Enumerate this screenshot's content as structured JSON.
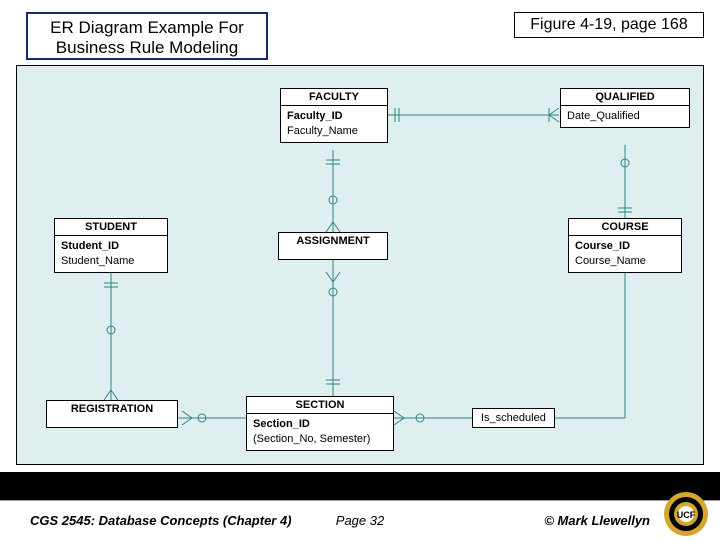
{
  "header": {
    "left_line1": "ER Diagram Example For",
    "left_line2": "Business Rule Modeling",
    "right": "Figure 4-19, page 168"
  },
  "entities": {
    "faculty": {
      "title": "FACULTY",
      "pk": "Faculty_ID",
      "a1": "Faculty_Name"
    },
    "qualified": {
      "title": "QUALIFIED",
      "a1": "Date_Qualified"
    },
    "student": {
      "title": "STUDENT",
      "pk": "Student_ID",
      "a1": "Student_Name"
    },
    "assignment": {
      "title": "ASSIGNMENT"
    },
    "course": {
      "title": "COURSE",
      "pk": "Course_ID",
      "a1": "Course_Name"
    },
    "section": {
      "title": "SECTION",
      "pk": "Section_ID",
      "a1": "(Section_No, Semester)"
    }
  },
  "relationships": {
    "registration": "REGISTRATION",
    "is_scheduled": "Is_scheduled"
  },
  "footer": {
    "left": "CGS 2545: Database Concepts  (Chapter 4)",
    "center": "Page 32",
    "right": "© Mark Llewellyn"
  }
}
